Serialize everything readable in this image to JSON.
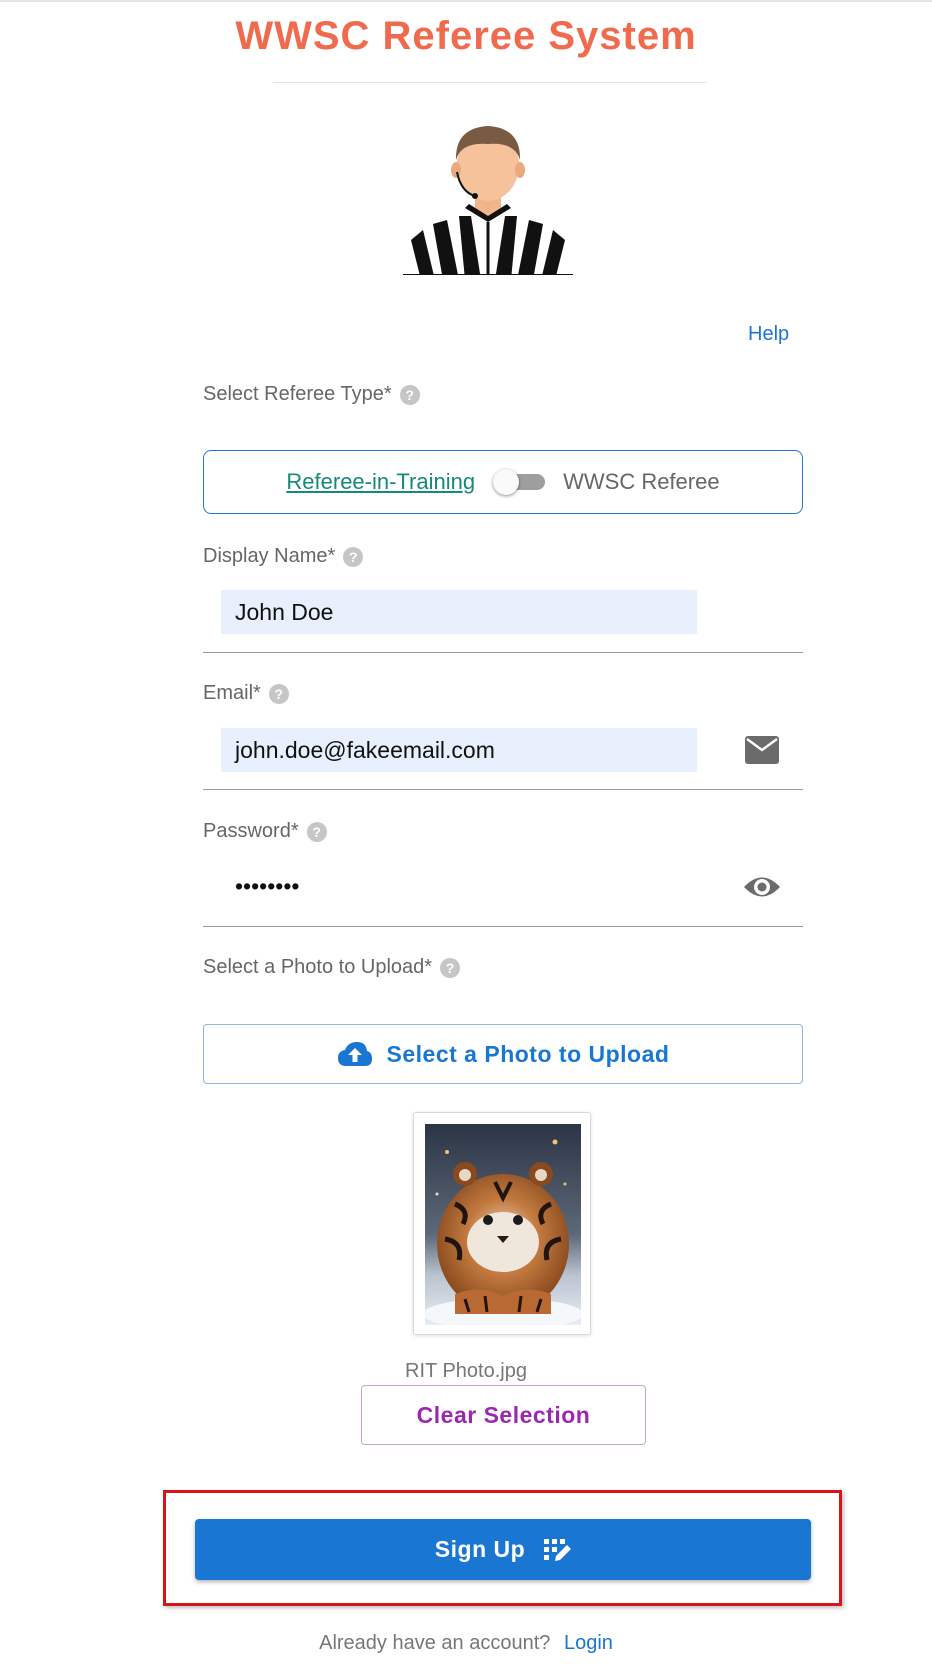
{
  "app": {
    "title": "WWSC Referee System"
  },
  "header": {
    "help_label": "Help"
  },
  "referee_type": {
    "label": "Select Referee Type*",
    "option_left": "Referee-in-Training",
    "option_right": "WWSC Referee"
  },
  "display_name": {
    "label": "Display Name*",
    "value": "John Doe"
  },
  "email": {
    "label": "Email*",
    "value": "john.doe@fakeemail.com"
  },
  "password": {
    "label": "Password*",
    "value": "••••••••"
  },
  "photo": {
    "label": "Select a Photo to Upload*",
    "button_label": "Select a Photo to Upload",
    "filename": "RIT Photo.jpg",
    "clear_label": "Clear Selection"
  },
  "actions": {
    "signup_label": "Sign Up"
  },
  "footer": {
    "prompt": "Already have an account?",
    "login_label": "Login"
  },
  "colors": {
    "title": "#f06a4e",
    "primary": "#1976d2",
    "secondary": "#9c27b0",
    "highlight": "#d9131c"
  },
  "icons": [
    "help-circle-icon",
    "email-icon",
    "visibility-icon",
    "cloud-upload-icon",
    "sign-up-icon"
  ]
}
